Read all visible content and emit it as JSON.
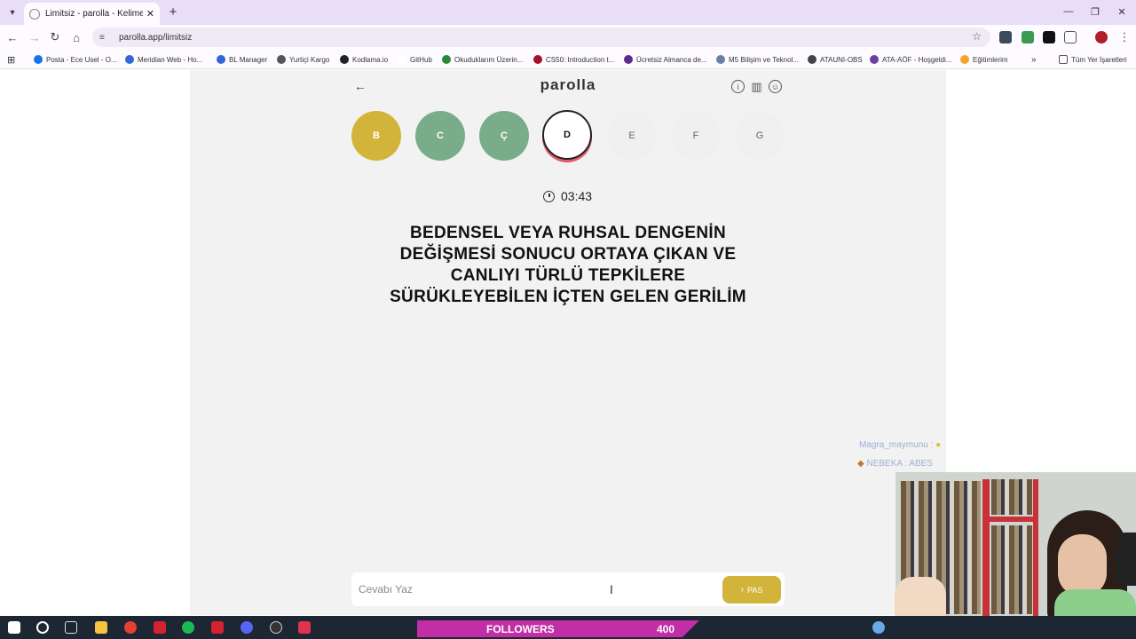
{
  "browser": {
    "tab_title": "Limitsiz - parolla - Kelime oyun",
    "url": "parolla.app/limitsiz",
    "bookmarks": [
      {
        "label": "Posta - Ece Usel - O...",
        "color": "#1a73e8"
      },
      {
        "label": "Meridian Web - Ho...",
        "color": "#3367d6"
      },
      {
        "label": "BL Manager",
        "color": "#3367d6"
      },
      {
        "label": "Yurtiçi Kargo",
        "color": "#555555"
      },
      {
        "label": "Kodlama.io",
        "color": "#222222"
      },
      {
        "label": "GitHub",
        "color": "#ffffff"
      },
      {
        "label": "Okuduklarım Üzerin...",
        "color": "#2a8a3a"
      },
      {
        "label": "CS50: Introduction t...",
        "color": "#a3122c"
      },
      {
        "label": "Ücretsiz Almanca de...",
        "color": "#5b2c8a"
      },
      {
        "label": "M5 Bilişim ve Teknol...",
        "color": "#6a7fa8"
      },
      {
        "label": "ATAUNI-OBS",
        "color": "#444444"
      },
      {
        "label": "ATA-AÖF - Hoşgeldi...",
        "color": "#6b3fa0"
      },
      {
        "label": "Eğitimlerim",
        "color": "#f4a52a"
      }
    ],
    "all_bookmarks": "Tüm Yer İşaretleri"
  },
  "game": {
    "logo": "parolla",
    "letters": [
      {
        "char": "B",
        "state": "passed",
        "color": "#d3b43a"
      },
      {
        "char": "C",
        "state": "correct",
        "color": "#79ad8a"
      },
      {
        "char": "Ç",
        "state": "correct",
        "color": "#79ad8a"
      },
      {
        "char": "D",
        "state": "active"
      },
      {
        "char": "E",
        "state": "inactive"
      },
      {
        "char": "F",
        "state": "inactive"
      },
      {
        "char": "G",
        "state": "inactive"
      }
    ],
    "timer": "03:43",
    "question": "BEDENSEL VEYA RUHSAL DENGENİN DEĞİŞMESİ SONUCU ORTAYA ÇIKAN VE CANLIYI TÜRLÜ TEPKİLERE SÜRÜKLEYEBİLEN İÇTEN GELEN GERİLİM",
    "answer_placeholder": "Cevabı Yaz",
    "pass_label": "PAS"
  },
  "overlay": {
    "chat": [
      {
        "user": "Magra_maymunu :"
      },
      {
        "user": "NEBEKA : ABES"
      }
    ],
    "followers_label": "FOLLOWERS",
    "followers_count": "400"
  }
}
